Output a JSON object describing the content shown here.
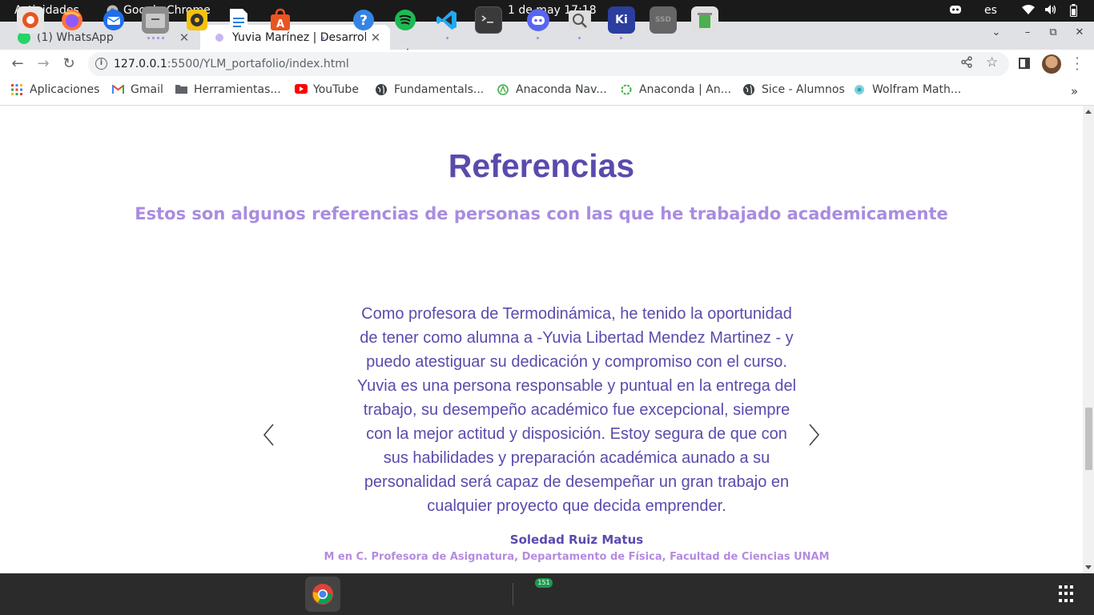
{
  "topbar": {
    "activities": "Actividades",
    "app_name": "Google Chrome",
    "clock": "1 de may  17:18",
    "language": "es"
  },
  "tabs": [
    {
      "title": "(1) WhatsApp",
      "favicon_color": "#25d366",
      "active": false
    },
    {
      "title": "Yuvia Marínez | Desarrollo",
      "favicon_color": "#a98ce0",
      "active": true
    }
  ],
  "toolbar": {
    "url_host": "127.0.0.1",
    "url_rest": ":5500/YLM_portafolio/index.html"
  },
  "bookmarks": [
    {
      "label": "Aplicaciones",
      "icon": "apps-grid-icon"
    },
    {
      "label": "Gmail",
      "icon": "gmail-icon"
    },
    {
      "label": "Herramientas...",
      "icon": "folder-icon"
    },
    {
      "label": "YouTube",
      "icon": "youtube-icon"
    },
    {
      "label": "Fundamentals...",
      "icon": "globe-icon"
    },
    {
      "label": "Anaconda Nav...",
      "icon": "anaconda-icon"
    },
    {
      "label": "Anaconda | An...",
      "icon": "anaconda-ring-icon"
    },
    {
      "label": "Sice - Alumnos",
      "icon": "globe-icon"
    },
    {
      "label": "Wolfram Math...",
      "icon": "wolfram-icon"
    }
  ],
  "content": {
    "title": "Referencias",
    "subtitle": "Estos son algunos referencias de personas con las que he trabajado academicamente",
    "quote": "Como profesora de Termodinámica, he tenido la oportunidad de tener como alumna a -Yuvia Libertad Mendez Martinez - y puedo atestiguar su dedicación y compromiso con el curso. Yuvia es una persona responsable y puntual en la entrega del trabajo, su desempeño académico fue excepcional, siempre con la mejor actitud y disposición. Estoy segura de que con sus habilidades y preparación académica aunado a su personalidad será capaz de desempeñar un gran trabajo en cualquier proyecto que decida emprender.",
    "author": "Soledad Ruiz Matus",
    "author_role": "M en C. Profesora de Asignatura, Departamento de Física, Facultad de Ciencias UNAM",
    "accent_color": "#5b4aad",
    "subtitle_color": "#a98ce0"
  },
  "dock": {
    "discord_badge": "151",
    "items": [
      "ubuntu-help-icon",
      "firefox-icon",
      "thunderbird-icon",
      "files-icon",
      "rhythmbox-icon",
      "libreoffice-writer-icon",
      "software-center-icon",
      "chrome-icon",
      "help-icon",
      "spotify-icon",
      "vscode-icon",
      "terminal-icon",
      "discord-icon",
      "image-viewer-icon",
      "kicad-icon",
      "disk-icon",
      "trash-icon"
    ]
  }
}
